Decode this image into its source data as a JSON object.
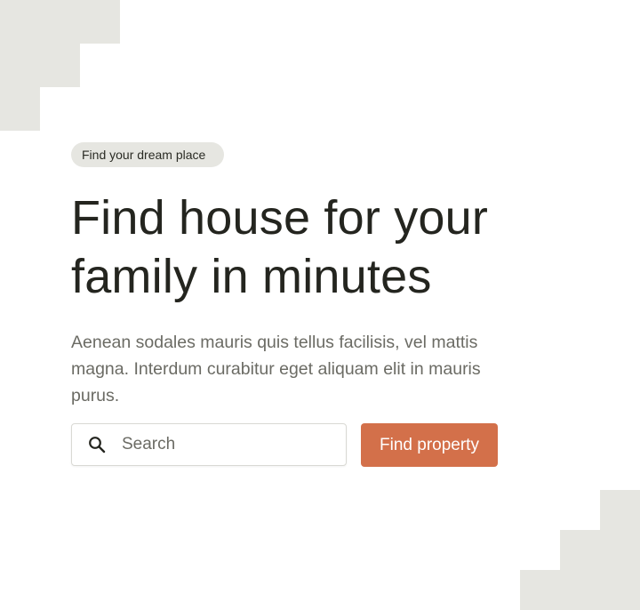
{
  "hero": {
    "badge": "Find your dream place",
    "title_line1": "Find house for your",
    "title_line2": "family in minutes",
    "subtitle": "Aenean sodales mauris quis tellus facilisis, vel mattis magna. Interdum curabitur eget aliquam elit in mauris purus."
  },
  "search": {
    "placeholder": "Search",
    "value": "",
    "icon": "search-icon",
    "button_label": "Find property"
  },
  "colors": {
    "accent": "#d3704a",
    "decor": "#e6e6e1",
    "heading": "#24251f",
    "body_text": "#6b6b64"
  }
}
